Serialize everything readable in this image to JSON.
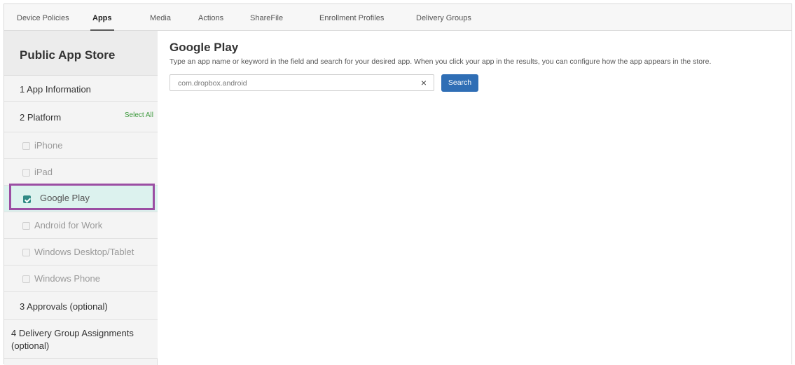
{
  "tabs": [
    "Device Policies",
    "Apps",
    "Media",
    "Actions",
    "ShareFile",
    "Enrollment Profiles",
    "Delivery Groups"
  ],
  "active_tab": "Apps",
  "sidebar": {
    "title": "Public App Store",
    "step1": "1  App Information",
    "step2": "2  Platform",
    "select_all": "Select All",
    "platforms": [
      {
        "label": "iPhone",
        "checked": false
      },
      {
        "label": "iPad",
        "checked": false
      },
      {
        "label": "Google Play",
        "checked": true
      },
      {
        "label": "Android for Work",
        "checked": false
      },
      {
        "label": "Windows Desktop/Tablet",
        "checked": false
      },
      {
        "label": "Windows Phone",
        "checked": false
      }
    ],
    "step3": "3  Approvals (optional)",
    "step4": "4  Delivery Group Assignments (optional)"
  },
  "main": {
    "title": "Google Play",
    "description": "Type an app name or keyword in the field and search for your desired app. When you click your app in the results, you can configure how the app appears in the store.",
    "search_value": "com.dropbox.android",
    "clear_icon": "×",
    "search_label": "Search"
  },
  "colors": {
    "accent": "#2f6eb5",
    "highlight_border": "#9b4ea3",
    "select_all": "#3e9a3e"
  }
}
